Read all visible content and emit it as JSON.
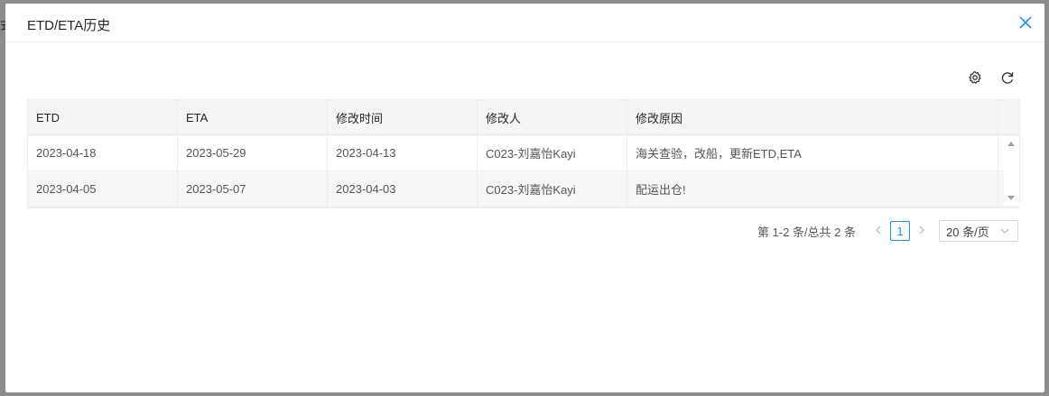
{
  "backdrop": {
    "glyph": "式"
  },
  "modal": {
    "title": "ETD/ETA历史",
    "close_icon": "close-icon"
  },
  "toolbar": {
    "settings_icon": "gear-icon",
    "refresh_icon": "refresh-icon"
  },
  "table": {
    "columns": [
      "ETD",
      "ETA",
      "修改时间",
      "修改人",
      "修改原因"
    ],
    "rows": [
      [
        "2023-04-18",
        "2023-05-29",
        "2023-04-13",
        "C023-刘嘉怡Kayi",
        "海关查验，改船，更新ETD,ETA"
      ],
      [
        "2023-04-05",
        "2023-05-07",
        "2023-04-03",
        "C023-刘嘉怡Kayi",
        "配运出仓!"
      ]
    ]
  },
  "pagination": {
    "total_text": "第 1-2 条/总共 2 条",
    "current_page": "1",
    "page_size": "20 条/页"
  },
  "colors": {
    "accent": "#1890ff",
    "header_bg": "#f5f5f5",
    "alt_row_bg": "#f7f7f7"
  }
}
